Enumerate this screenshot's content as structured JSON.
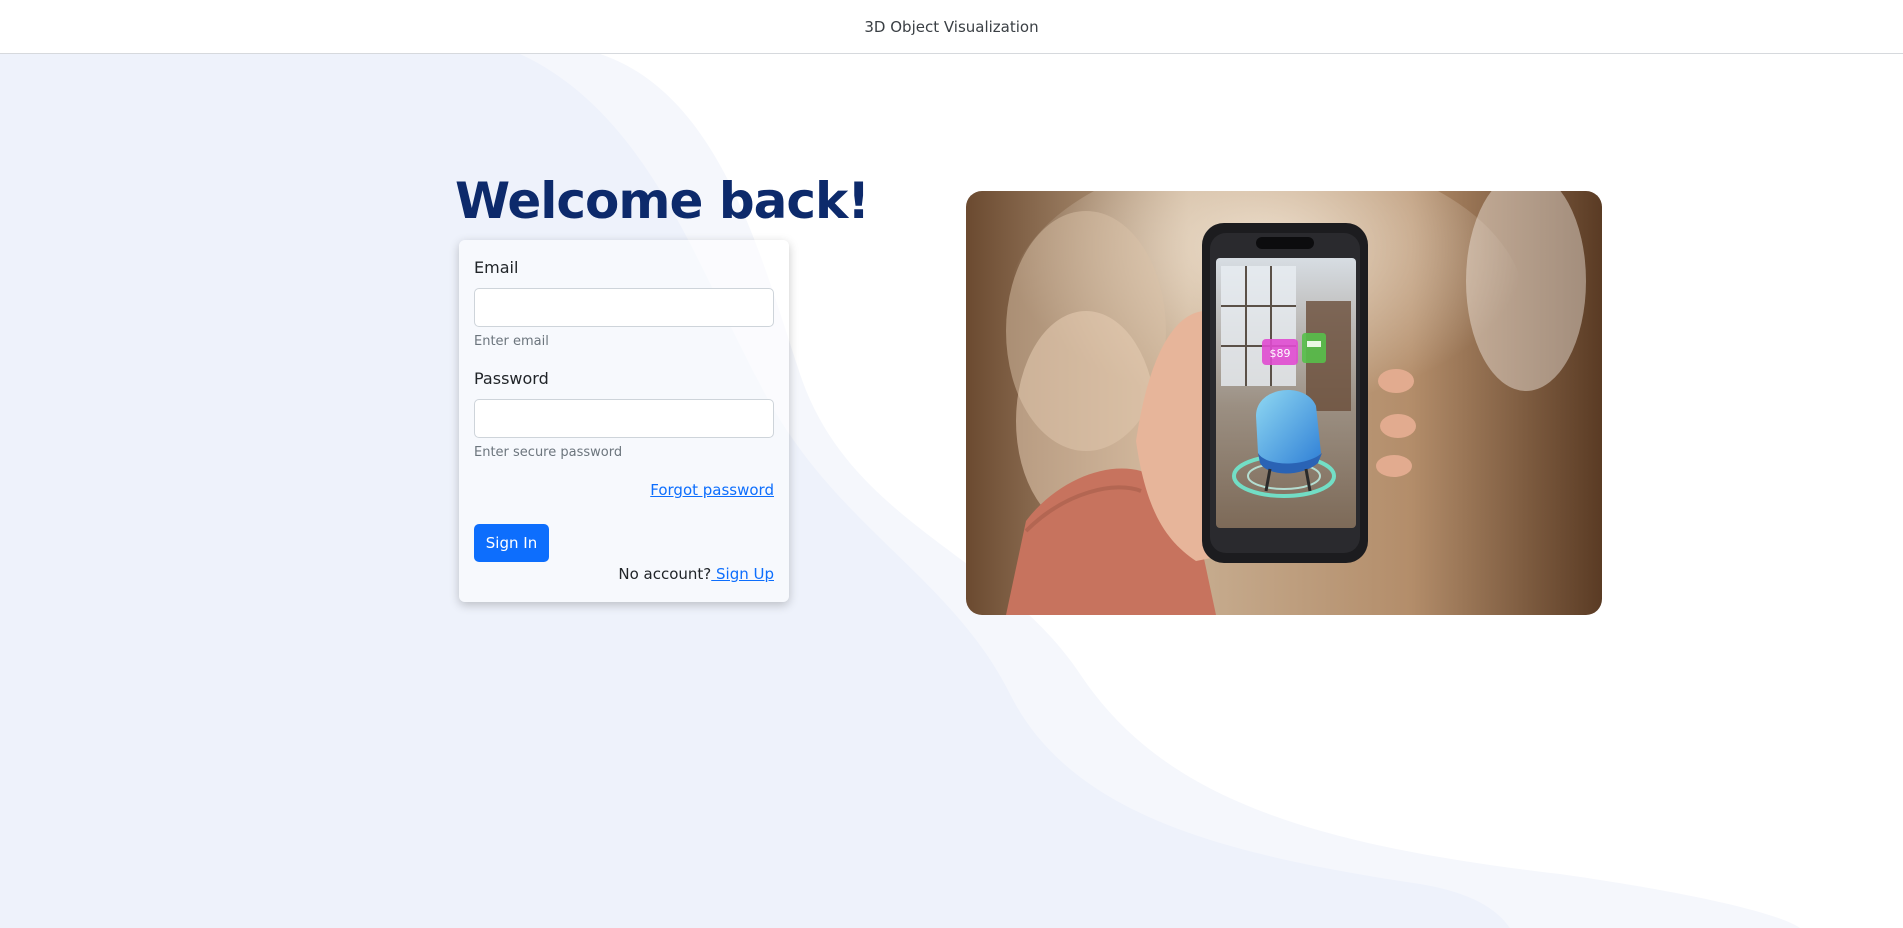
{
  "header": {
    "title": "3D Object Visualization"
  },
  "login": {
    "heading": "Welcome back!",
    "email": {
      "label": "Email",
      "value": "",
      "placeholder": "",
      "help": "Enter email"
    },
    "password": {
      "label": "Password",
      "value": "",
      "placeholder": "",
      "help": "Enter secure password"
    },
    "forgot_label": "Forgot password",
    "signin_label": "Sign In",
    "no_account_text": "No account?",
    "signup_label": " Sign Up"
  },
  "hero": {
    "icon": "ar-phone-chair-photo",
    "price_tag_text": "$89"
  },
  "colors": {
    "accent": "#0d6efd",
    "heading": "#0d2a6b",
    "background_wave": "#eef2fb"
  }
}
